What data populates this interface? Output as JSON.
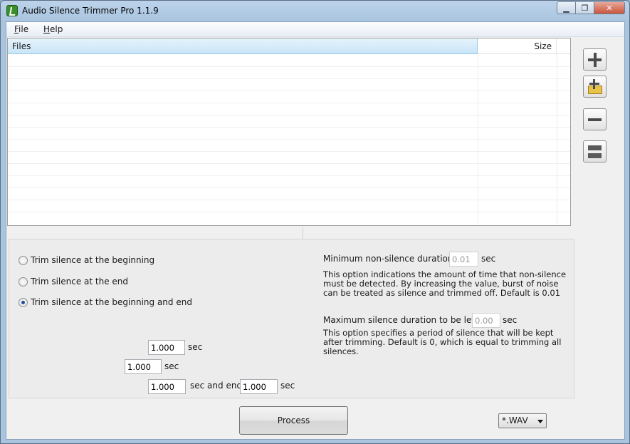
{
  "window": {
    "title": "Audio Silence Trimmer Pro 1.1.9"
  },
  "menu": {
    "file": "F",
    "file_rest": "ile",
    "help": "H",
    "help_rest": "elp"
  },
  "filelist": {
    "col_files": "Files",
    "col_size": "Size",
    "rows": []
  },
  "side_buttons": {
    "add_icon": "plus-icon",
    "add_folder_icon": "folder-add-icon",
    "remove_icon": "minus-icon",
    "clear_icon": "clear-all-icon"
  },
  "options": {
    "radio_begin": "Trim silence at the beginning",
    "radio_end": "Trim silence at the end",
    "radio_both": "Trim silence at the beginning and end",
    "selected": "both",
    "begin_value": "1.000",
    "end_value": "1.000",
    "both_begin_value": "1.000",
    "both_end_value": "1.000",
    "sec": "sec",
    "sec_and_end": "sec and end",
    "min_nonsilence_label": "Minimum non-silence duration",
    "min_nonsilence_value": "0.01",
    "min_nonsilence_desc_1": "This option indications the amount of time that non-silence",
    "min_nonsilence_desc_2": "must be detected. By increasing the value, burst of noise",
    "min_nonsilence_desc_3": "can be treated as silence and trimmed off. Default is 0.01",
    "max_silence_label": "Maximum silence duration to be left",
    "max_silence_value": "0.00",
    "max_silence_desc_1": "This option specifies a period of silence that will be kept",
    "max_silence_desc_2": "after trimming. Default is 0, which is equal to trimming all",
    "max_silence_desc_3": "silences."
  },
  "actions": {
    "process": "Process",
    "format": "*.WAV"
  }
}
